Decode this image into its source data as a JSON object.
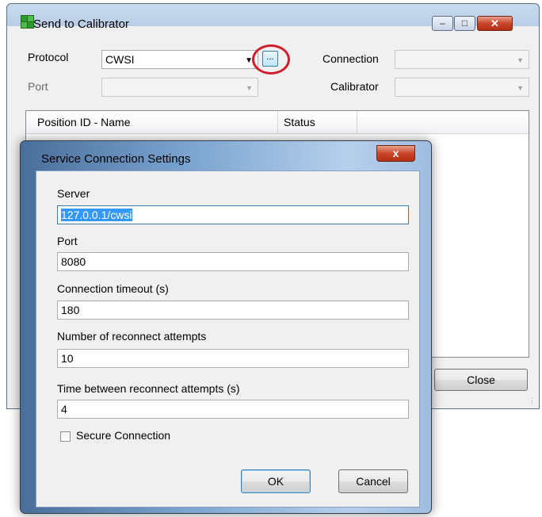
{
  "main_window": {
    "title": "Send to Calibrator",
    "caption_buttons": {
      "minimize": "–",
      "maximize": "□",
      "close": "✕"
    },
    "protocol_label": "Protocol",
    "protocol_value": "CWSI",
    "ellipsis_label": "...",
    "port_label": "Port",
    "port_value": "",
    "connection_label": "Connection",
    "connection_value": "",
    "calibrator_label": "Calibrator",
    "calibrator_value": "",
    "list_columns": [
      "Position ID - Name",
      "Status"
    ],
    "close_button": "Close",
    "highlight_color": "#d01f2c"
  },
  "dialog": {
    "title": "Service Connection Settings",
    "close_glyph": "x",
    "fields": [
      {
        "label": "Server",
        "value": "127.0.0.1/cwsi"
      },
      {
        "label": "Port",
        "value": "8080"
      },
      {
        "label": "Connection timeout (s)",
        "value": "180"
      },
      {
        "label": "Number of reconnect attempts",
        "value": "10"
      },
      {
        "label": "Time between reconnect attempts (s)",
        "value": "4"
      }
    ],
    "secure_connection_label": "Secure Connection",
    "secure_connection_checked": false,
    "ok_button": "OK",
    "cancel_button": "Cancel"
  }
}
